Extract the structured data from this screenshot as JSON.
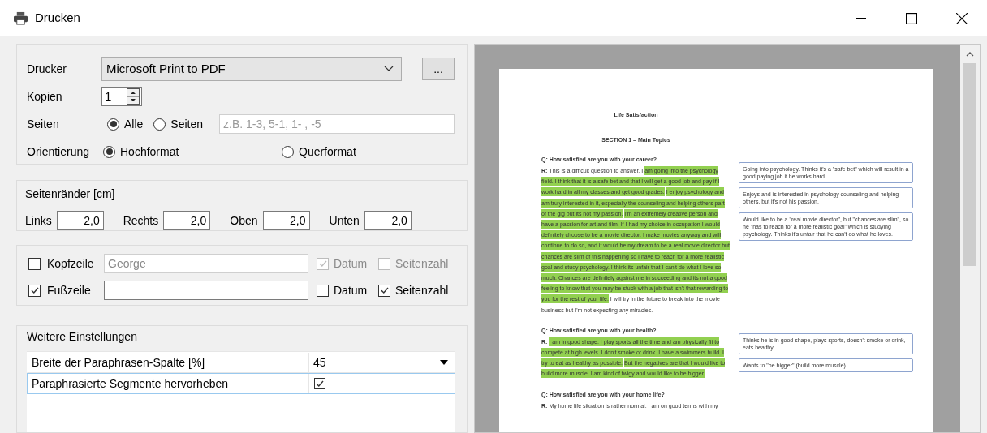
{
  "window": {
    "title": "Drucken"
  },
  "printer": {
    "label": "Drucker",
    "value": "Microsoft Print to PDF",
    "more_button": "..."
  },
  "copies": {
    "label": "Kopien",
    "value": "1"
  },
  "pages": {
    "label": "Seiten",
    "options": [
      {
        "label": "Alle",
        "selected": true
      },
      {
        "label": "Seiten",
        "selected": false
      }
    ],
    "placeholder": "z.B. 1-3, 5-1, 1- , -5"
  },
  "orientation": {
    "label": "Orientierung",
    "options": [
      {
        "label": "Hochformat",
        "selected": true
      },
      {
        "label": "Querformat",
        "selected": false
      }
    ]
  },
  "margins": {
    "title": "Seitenränder [cm]",
    "fields": [
      {
        "label": "Links",
        "value": "2,0"
      },
      {
        "label": "Rechts",
        "value": "2,0"
      },
      {
        "label": "Oben",
        "value": "2,0"
      },
      {
        "label": "Unten",
        "value": "2,0"
      }
    ]
  },
  "header_footer": [
    {
      "label": "Kopfzeile",
      "checked": false,
      "value": "George",
      "disabled": true,
      "options": [
        {
          "label": "Datum",
          "checked": true
        },
        {
          "label": "Seitenzahl",
          "checked": false
        }
      ]
    },
    {
      "label": "Fußzeile",
      "checked": true,
      "disabled": false,
      "options": [
        {
          "label": "Datum",
          "checked": false
        },
        {
          "label": "Seitenzahl",
          "checked": true
        }
      ]
    }
  ],
  "settings": {
    "title": "Weitere Einstellungen",
    "rows": [
      {
        "kind": "dropdown",
        "label": "Breite der Paraphrasen-Spalte [%]",
        "value": "45",
        "selected": false
      },
      {
        "kind": "checkbox",
        "label": "Paraphrasierte Segmente hervorheben",
        "checked": true,
        "selected": true
      }
    ]
  },
  "preview": {
    "title": "Life Satisfaction",
    "section": "SECTION 1 – Main Topics",
    "questions": [
      {
        "question": "Q: How satisfied are you with your career?",
        "answer_label": "R:",
        "segments": [
          {
            "text": "This is a difficult question to answer. I",
            "highlighted": false
          },
          {
            "text": "am going into the psychology field. I think that it is a safe bet and that I will get a good job and pay if I work hard in all my classes and get good grades.",
            "highlighted": true
          },
          {
            "text": "I enjoy psychology and am truly interested in it, especially the counseling and helping others part of the gig but its not my passion.",
            "highlighted": true
          },
          {
            "text": "I'm an extremely creative person and have a passion for art and film. If I had my choice in occupation I would definitely choose to be a movie director. I make movies anyway and will continue to do so, and it would be my dream to be a real movie director but chances are slim of this happening so I have to reach for a more realistic goal and study psychology. I think its unfair that I can't do what I love so much. Chances are definitely against me in succeeding and its not a good feeling to know that you may be stuck with a job that isn't that rewarding to you for the rest of your life.",
            "highlighted": true
          },
          {
            "text": "I will try in the future to break into the movie business but I'm not expecting any miracles.",
            "highlighted": false
          }
        ],
        "comments": [
          "Going into psychology. Thinks it's a \"safe bet\" which will result in a good paying job if he works hard.",
          "Enjoys and is interested in psychology counseling and helping others, but it's not his passion.",
          "Would like to be a \"real movie director\", but \"chances are slim\", so he \"has to reach for a more realistic goal\" which is studying psychology. Thinks it's unfair that he can't do what he loves."
        ]
      },
      {
        "question": "Q: How satisfied are you with your health?",
        "answer_label": "R:",
        "segments": [
          {
            "text": "I am in good shape. I play sports all the time and am physically fit to compete at high levels. I don't smoke or drink. I have a swimmers build. I try to eat as healthy as possible.",
            "highlighted": true
          },
          {
            "text": "But the negatives are that I would like to build more muscle. I am kind of twigy and would like to be bigger.",
            "highlighted": true
          }
        ],
        "comments": [
          "Thinks he is in good shape, plays sports, doesn't smoke or drink, eats healthy.",
          "Wants to \"be bigger\" (build more muscle)."
        ]
      },
      {
        "question": "Q: How satisfied are you with your home life?",
        "answer_label": "R:",
        "segments": [
          {
            "text": "My home life situation is rather normal. I am on good terms with my",
            "highlighted": false
          }
        ]
      }
    ]
  }
}
